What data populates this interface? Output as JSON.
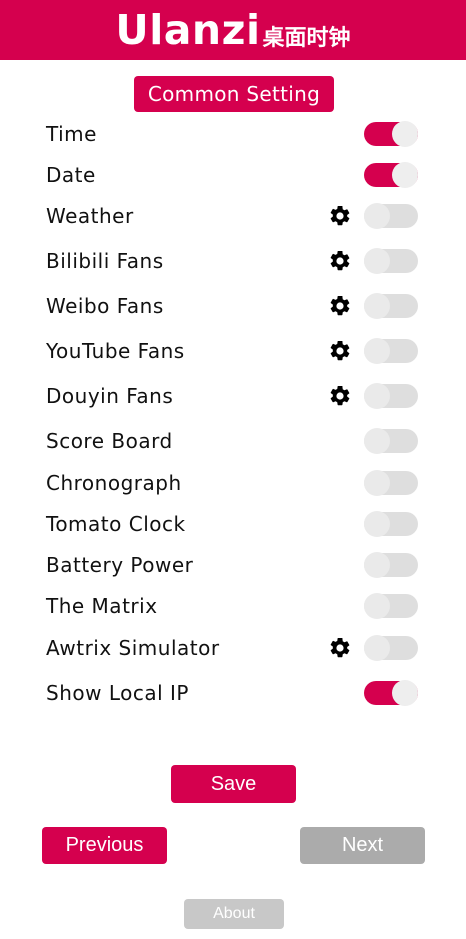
{
  "header": {
    "brand": "Ulanzi",
    "brand_sub": "桌面时钟"
  },
  "section": {
    "title": "Common Setting"
  },
  "settings": [
    {
      "label": "Time",
      "enabled": true,
      "has_settings": false
    },
    {
      "label": "Date",
      "enabled": true,
      "has_settings": false
    },
    {
      "label": "Weather",
      "enabled": false,
      "has_settings": true
    },
    {
      "label": "Bilibili Fans",
      "enabled": false,
      "has_settings": true
    },
    {
      "label": "Weibo Fans",
      "enabled": false,
      "has_settings": true
    },
    {
      "label": "YouTube Fans",
      "enabled": false,
      "has_settings": true
    },
    {
      "label": "Douyin Fans",
      "enabled": false,
      "has_settings": true
    },
    {
      "label": "Score Board",
      "enabled": false,
      "has_settings": false
    },
    {
      "label": "Chronograph",
      "enabled": false,
      "has_settings": false
    },
    {
      "label": "Tomato Clock",
      "enabled": false,
      "has_settings": false
    },
    {
      "label": "Battery Power",
      "enabled": false,
      "has_settings": false
    },
    {
      "label": "The Matrix",
      "enabled": false,
      "has_settings": false
    },
    {
      "label": "Awtrix Simulator",
      "enabled": false,
      "has_settings": true
    },
    {
      "label": "Show Local IP",
      "enabled": true,
      "has_settings": false
    }
  ],
  "actions": {
    "save_label": "Save",
    "previous_label": "Previous",
    "next_label": "Next",
    "about_label": "About"
  },
  "colors": {
    "accent": "#d5004e",
    "disabled": "#ababab",
    "toggle_off": "#dedede"
  },
  "icons": {
    "row_settings": "gear-icon"
  }
}
